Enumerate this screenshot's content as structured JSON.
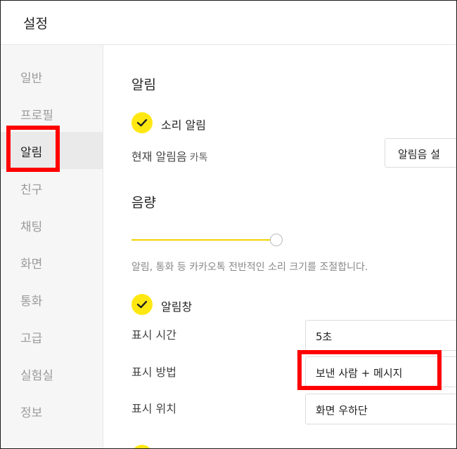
{
  "window": {
    "title": "설정"
  },
  "sidebar": {
    "items": [
      {
        "label": "일반",
        "active": false
      },
      {
        "label": "프로필",
        "active": false
      },
      {
        "label": "알림",
        "active": true
      },
      {
        "label": "친구",
        "active": false
      },
      {
        "label": "채팅",
        "active": false
      },
      {
        "label": "화면",
        "active": false
      },
      {
        "label": "통화",
        "active": false
      },
      {
        "label": "고급",
        "active": false
      },
      {
        "label": "실험실",
        "active": false
      },
      {
        "label": "정보",
        "active": false
      }
    ]
  },
  "notifications": {
    "section_title": "알림",
    "sound_checkbox": {
      "label": "소리 알림",
      "checked": true
    },
    "current_sound": {
      "label": "현재 알림음",
      "value": "카톡",
      "button_label": "알림음 설"
    }
  },
  "volume": {
    "section_title": "음량",
    "level": 0.98,
    "description": "알림, 통화 등 카카오톡 전반적인 소리 크기를 조절합니다."
  },
  "popup": {
    "checkbox": {
      "label": "알림창",
      "checked": true
    },
    "display_time": {
      "label": "표시 시간",
      "value": "5초"
    },
    "display_method": {
      "label": "표시 방법",
      "value": "보낸 사람 + 메시지"
    },
    "display_position": {
      "label": "표시 위치",
      "value": "화면 우하단"
    }
  },
  "colors": {
    "accent": "#ffe812",
    "highlight": "#ff0000"
  }
}
